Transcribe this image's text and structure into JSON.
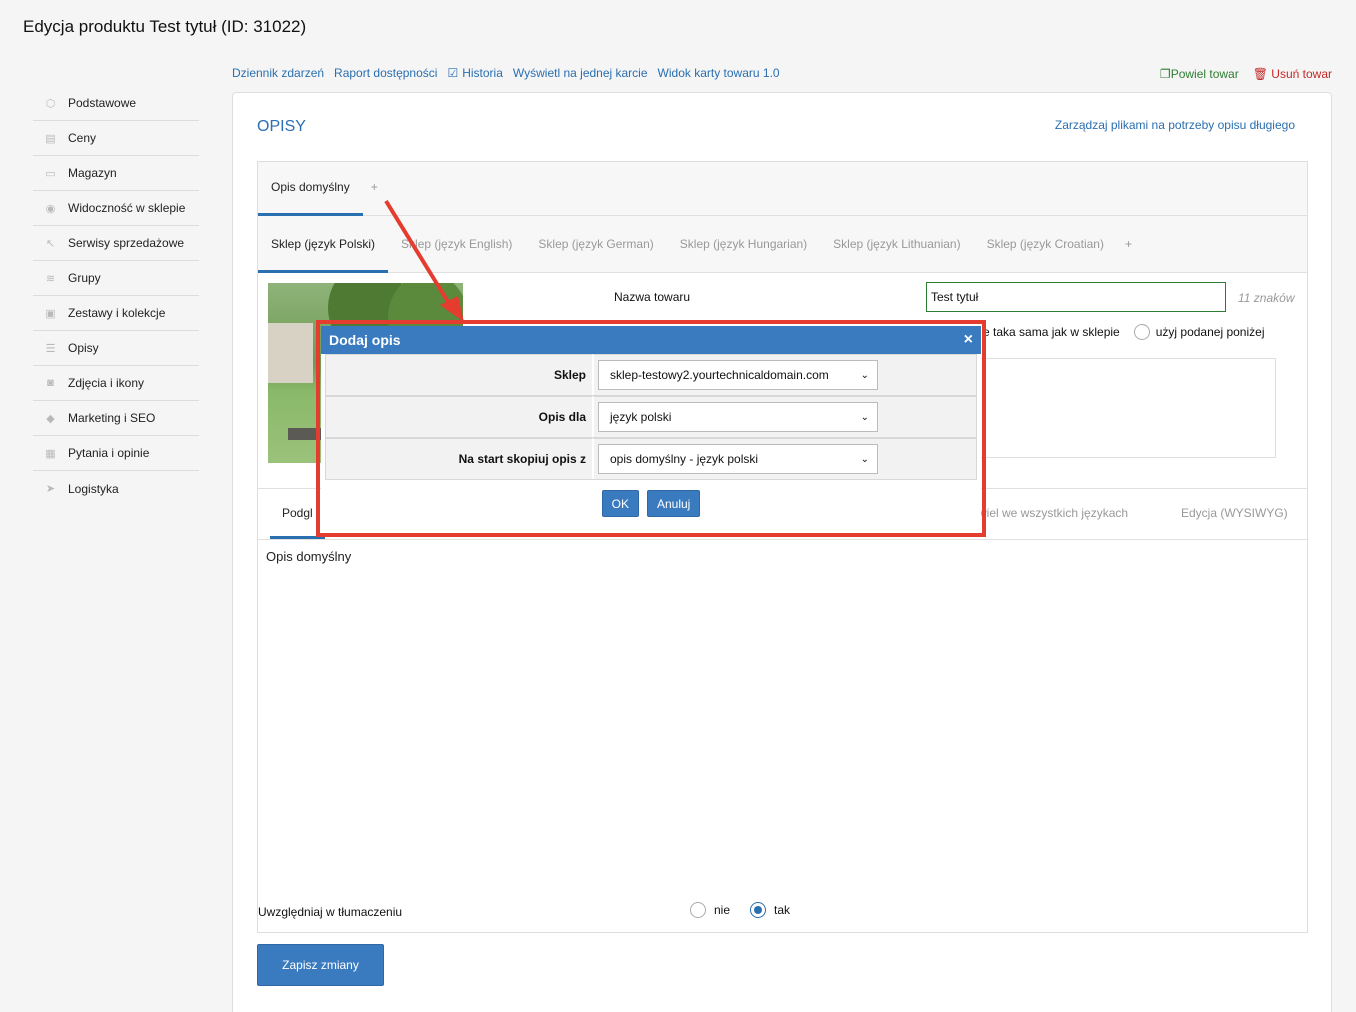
{
  "page": {
    "title": "Edycja produktu Test tytuł (ID: 31022)"
  },
  "sidebar": {
    "items": [
      {
        "label": "Podstawowe",
        "icon": "cube-icon"
      },
      {
        "label": "Ceny",
        "icon": "price-icon"
      },
      {
        "label": "Magazyn",
        "icon": "warehouse-icon"
      },
      {
        "label": "Widoczność w sklepie",
        "icon": "eye-icon"
      },
      {
        "label": "Serwisy sprzedażowe",
        "icon": "cursor-icon"
      },
      {
        "label": "Grupy",
        "icon": "layers-icon"
      },
      {
        "label": "Zestawy i kolekcje",
        "icon": "collection-icon"
      },
      {
        "label": "Opisy",
        "icon": "list-icon"
      },
      {
        "label": "Zdjęcia i ikony",
        "icon": "camera-icon"
      },
      {
        "label": "Marketing i SEO",
        "icon": "tag-icon"
      },
      {
        "label": "Pytania i opinie",
        "icon": "chat-icon"
      },
      {
        "label": "Logistyka",
        "icon": "plane-icon"
      }
    ]
  },
  "toplinks": {
    "journal": "Dziennik zdarzeń",
    "availability": "Raport dostępności",
    "history": "Historia",
    "one_card": "Wyświetl na jednej karcie",
    "card_view": "Widok karty towaru 1.0"
  },
  "actions": {
    "copy": "Powiel towar",
    "delete": "Usuń towar"
  },
  "panel": {
    "title": "OPISY",
    "manage_files": "Zarządzaj plikami na potrzeby opisu długiego",
    "desc_tabs": [
      "Opis domyślny"
    ],
    "plus": "+",
    "shop_tabs": [
      "Sklep (język Polski)",
      "Sklep (język English)",
      "Sklep (język German)",
      "Sklep (język Hungarian)",
      "Sklep (język Lithuanian)",
      "Sklep (język Croatian)"
    ],
    "name_label": "Nazwa towaru",
    "name_value": "Test tytuł",
    "char_count": "11 znaków",
    "radio_same": "e taka sama jak w sklepie",
    "radio_custom": "użyj podanej poniżej",
    "tab_preview": "Podgl",
    "tab_copy_all": "wiel we wszystkich językach",
    "tab_wysiwyg": "Edycja (WYSIWYG)",
    "preview_text": "Opis domyślny",
    "translate_label": "Uwzględniaj w tłumaczeniu",
    "translate_no": "nie",
    "translate_yes": "tak",
    "save": "Zapisz zmiany"
  },
  "modal": {
    "title": "Dodaj opis",
    "close": "×",
    "rows": [
      {
        "label": "Sklep",
        "value": "sklep-testowy2.yourtechnicaldomain.com"
      },
      {
        "label": "Opis dla",
        "value": "język polski"
      },
      {
        "label": "Na start skopiuj opis z",
        "value": "opis domyślny - język polski"
      }
    ],
    "ok": "OK",
    "cancel": "Anuluj"
  },
  "colors": {
    "accent": "#3a7bc0",
    "highlight": "#e43c2f",
    "link": "#2a6fb0"
  }
}
